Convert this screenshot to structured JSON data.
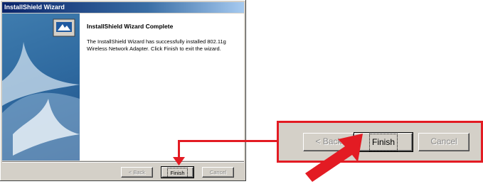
{
  "window": {
    "title": "InstallShield Wizard"
  },
  "content": {
    "heading": "InstallShield Wizard Complete",
    "message": "The InstallShield Wizard has successfully installed 802.11g Wireless Network Adapter.  Click Finish to exit the wizard."
  },
  "buttons": {
    "back": "< Back",
    "finish": "Finish",
    "cancel": "Cancel"
  },
  "zoom": {
    "back": "< Back",
    "finish": "Finish",
    "cancel": "Cancel"
  },
  "colors": {
    "highlight": "#e31b23",
    "title_bar": "#0a246a"
  },
  "icons": [
    "computer-icon",
    "pointer-arrow-icon"
  ]
}
